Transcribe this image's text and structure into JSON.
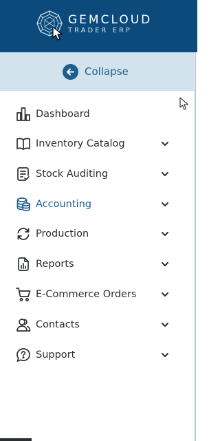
{
  "brand": {
    "title": "GEMCLOUD",
    "subtitle": "TRADER ERP",
    "logo_icon": "gem-logo-icon"
  },
  "collapse": {
    "label": "Collapse",
    "icon": "arrow-left-circle-icon"
  },
  "colors": {
    "header_bg": "#0b4a7a",
    "collapse_bg": "#d2e3ee",
    "accent": "#1e5d8c",
    "text": "#2b2f33"
  },
  "nav": {
    "items": [
      {
        "label": "Dashboard",
        "icon": "bar-chart-icon",
        "has_submenu": false,
        "active": false
      },
      {
        "label": "Inventory Catalog",
        "icon": "book-open-icon",
        "has_submenu": true,
        "active": false
      },
      {
        "label": "Stock Auditing",
        "icon": "clipboard-check-icon",
        "has_submenu": true,
        "active": false
      },
      {
        "label": "Accounting",
        "icon": "coins-stack-icon",
        "has_submenu": true,
        "active": true
      },
      {
        "label": "Production",
        "icon": "refresh-icon",
        "has_submenu": true,
        "active": false
      },
      {
        "label": "Reports",
        "icon": "report-chart-icon",
        "has_submenu": true,
        "active": false
      },
      {
        "label": "E-Commerce Orders",
        "icon": "shopping-cart-icon",
        "has_submenu": true,
        "active": false
      },
      {
        "label": "Contacts",
        "icon": "users-icon",
        "has_submenu": true,
        "active": false
      },
      {
        "label": "Support",
        "icon": "help-chat-icon",
        "has_submenu": true,
        "active": false
      }
    ]
  }
}
